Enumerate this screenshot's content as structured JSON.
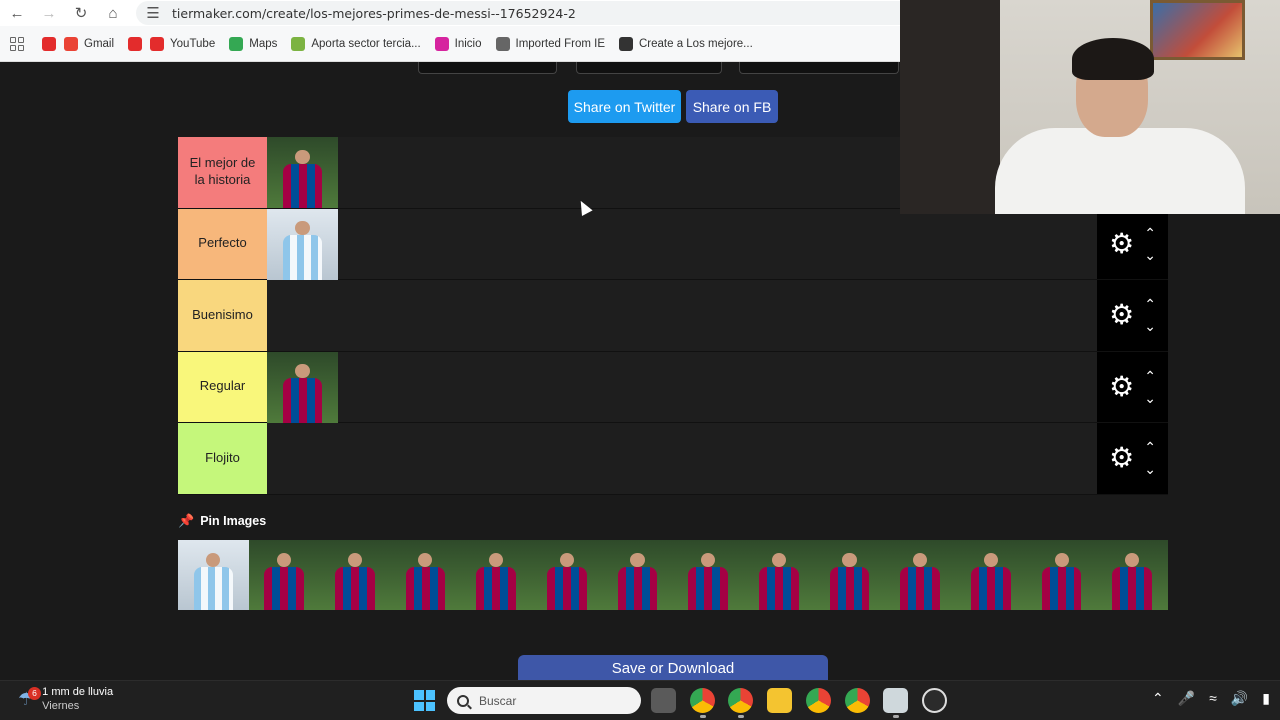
{
  "browser": {
    "url": "tiermaker.com/create/los-mejores-primes-de-messi--17652924-2",
    "bookmarks": [
      {
        "label": "",
        "color": "#e32c2c"
      },
      {
        "label": "Gmail",
        "color": "#ea4335"
      },
      {
        "label": "",
        "color": "#e32c2c"
      },
      {
        "label": "YouTube",
        "color": "#e32c2c"
      },
      {
        "label": "Maps",
        "color": "#34a853"
      },
      {
        "label": "Aporta sector tercia...",
        "color": "#7cb342"
      },
      {
        "label": "Inicio",
        "color": "#d6249f"
      },
      {
        "label": "Imported From IE",
        "color": "#666666"
      },
      {
        "label": "Create a Los mejore...",
        "color": "#333333"
      }
    ]
  },
  "share": {
    "twitter": "Share on Twitter",
    "fb": "Share on FB"
  },
  "tiers": [
    {
      "label": "El mejor de la historia",
      "color": "#f47c7c",
      "items": [
        "barca"
      ]
    },
    {
      "label": "Perfecto",
      "color": "#f7b77b",
      "items": [
        "argen"
      ]
    },
    {
      "label": "Buenisimo",
      "color": "#f9d77e",
      "items": []
    },
    {
      "label": "Regular",
      "color": "#f9f77b",
      "items": [
        "barca"
      ]
    },
    {
      "label": "Flojito",
      "color": "#c5f77b",
      "items": []
    }
  ],
  "pin_images": {
    "label": "Pin Images",
    "items": [
      "argen",
      "barca",
      "barca",
      "barca",
      "barca",
      "barca",
      "barca",
      "barca",
      "barca",
      "barca",
      "barca",
      "barca",
      "barca",
      "barca"
    ]
  },
  "save_button": "Save or Download",
  "taskbar": {
    "weather_badge": "6",
    "weather_main": "1 mm de lluvia",
    "weather_sub": "Viernes",
    "search_placeholder": "Buscar"
  }
}
